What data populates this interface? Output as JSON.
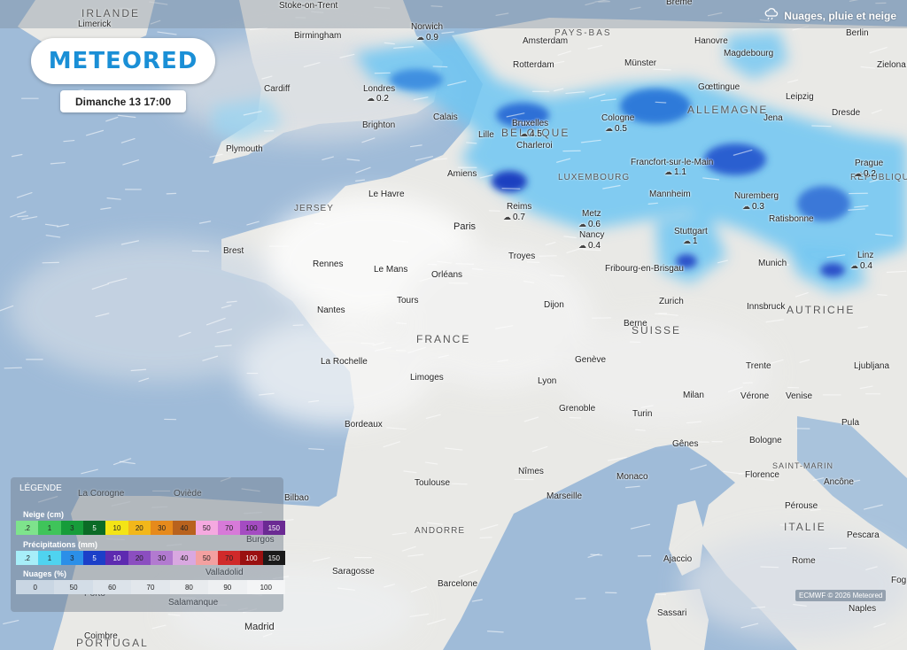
{
  "brand": {
    "name": "METEORED"
  },
  "datetime": "Dimanche 13 17:00",
  "layer": {
    "icon": "cloud-rain-snow-icon",
    "label": "Nuages, pluie et neige"
  },
  "countries": {
    "irlande": "IRLANDE",
    "pays_bas": "PAYS-BAS",
    "belgique": "BELGIQUE",
    "allemagne": "ALLEMAGNE",
    "luxembourg": "LUXEMBOURG",
    "france": "FRANCE",
    "suisse": "SUISSE",
    "autriche": "AUTRICHE",
    "republique": "RÉPUBLIQUE",
    "italie": "ITALIE",
    "saint_marin": "SAINT-MARIN",
    "andorre": "ANDORRE",
    "portugal": "PORTUGAL",
    "jersey": "JERSEY"
  },
  "cities": {
    "limerick": "Limerick",
    "stoke": "Stoke-on-Trent",
    "breme": "Brême",
    "birmingham": "Birmingham",
    "norwich": "Norwich",
    "amsterdam": "Amsterdam",
    "hanovre": "Hanovre",
    "berlin": "Berlin",
    "magdebourg": "Magdebourg",
    "zielona": "Zielona",
    "cardiff": "Cardiff",
    "londres": "Londres",
    "rotterdam": "Rotterdam",
    "munster": "Münster",
    "goettingue": "Gœttingue",
    "leipzig": "Leipzig",
    "dresde": "Dresde",
    "plymouth": "Plymouth",
    "brighton": "Brighton",
    "calais": "Calais",
    "bruxelles": "Bruxelles",
    "lille": "Lille",
    "charleroi": "Charleroi",
    "cologne": "Cologne",
    "jena": "Jena",
    "francfort": "Francfort-sur-le-Main",
    "prague": "Prague",
    "amiens": "Amiens",
    "le_havre": "Le Havre",
    "reims": "Reims",
    "metz": "Metz",
    "mannheim": "Mannheim",
    "nuremberg": "Nuremberg",
    "ratisbonne": "Ratisbonne",
    "paris": "Paris",
    "nancy": "Nancy",
    "stuttgart": "Stuttgart",
    "brest": "Brest",
    "rennes": "Rennes",
    "le_mans": "Le Mans",
    "orleans": "Orléans",
    "troyes": "Troyes",
    "fribourg": "Fribourg-en-Brisgau",
    "munich": "Munich",
    "linz": "Linz",
    "nantes": "Nantes",
    "tours": "Tours",
    "dijon": "Dijon",
    "zurich": "Zurich",
    "innsbruck": "Innsbruck",
    "berne": "Berne",
    "la_rochelle": "La Rochelle",
    "geneve": "Genève",
    "trente": "Trente",
    "ljubljana": "Ljubljana",
    "limoges": "Limoges",
    "lyon": "Lyon",
    "milan": "Milan",
    "verone": "Vérone",
    "venise": "Venise",
    "grenoble": "Grenoble",
    "turin": "Turin",
    "bordeaux": "Bordeaux",
    "pula": "Pula",
    "genes": "Gênes",
    "bologne": "Bologne",
    "la_corogne": "La Corogne",
    "oviede": "Oviède",
    "bilbao": "Bilbao",
    "toulouse": "Toulouse",
    "nimes": "Nîmes",
    "monaco": "Monaco",
    "florence": "Florence",
    "ancone": "Ancône",
    "marseille": "Marseille",
    "perouse": "Pérouse",
    "burgos": "Burgos",
    "pescara": "Pescara",
    "ajaccio": "Ajaccio",
    "rome": "Rome",
    "fog": "Fog",
    "saragosse": "Saragosse",
    "barcelone": "Barcelone",
    "valladolid": "Valladolid",
    "porto": "Porto",
    "salamanque": "Salamanque",
    "sassari": "Sassari",
    "naples": "Naples",
    "coimbre": "Coimbre",
    "madrid": "Madrid"
  },
  "precip_values": {
    "norwich": "0.9",
    "londres": "0.2",
    "bruxelles": "4.5",
    "cologne": "0.5",
    "francfort": "1.1",
    "prague": "0.2",
    "reims": "0.7",
    "metz": "0.6",
    "nancy": "0.4",
    "nuremberg": "0.3",
    "stuttgart": "1",
    "linz": "0.4"
  },
  "legend": {
    "title": "LÉGENDE",
    "snow": {
      "title": "Neige (cm)",
      "stops": [
        {
          "label": ".2",
          "color": "#7ee38c"
        },
        {
          "label": "1",
          "color": "#3fc45a"
        },
        {
          "label": "3",
          "color": "#169c3a"
        },
        {
          "label": "5",
          "color": "#0b6b26"
        },
        {
          "label": "10",
          "color": "#f3e416"
        },
        {
          "label": "20",
          "color": "#f2b71a"
        },
        {
          "label": "30",
          "color": "#e68a1c"
        },
        {
          "label": "40",
          "color": "#b8621e"
        },
        {
          "label": "50",
          "color": "#f5a9e0"
        },
        {
          "label": "70",
          "color": "#d77ad8"
        },
        {
          "label": "100",
          "color": "#a44cc2"
        },
        {
          "label": "150",
          "color": "#6b2a93"
        }
      ]
    },
    "rain": {
      "title": "Précipitations (mm)",
      "stops": [
        {
          "label": ".2",
          "color": "#a7eef9"
        },
        {
          "label": "1",
          "color": "#4fd3f0"
        },
        {
          "label": "3",
          "color": "#2b8fe8"
        },
        {
          "label": "5",
          "color": "#1c3fc8"
        },
        {
          "label": "10",
          "color": "#5d2ab0"
        },
        {
          "label": "20",
          "color": "#8b4ec0"
        },
        {
          "label": "30",
          "color": "#b27ad0"
        },
        {
          "label": "40",
          "color": "#d9a8e0"
        },
        {
          "label": "50",
          "color": "#f3a0a0"
        },
        {
          "label": "70",
          "color": "#d02a2a"
        },
        {
          "label": "100",
          "color": "#9a1010"
        },
        {
          "label": "150",
          "color": "#1a1a1a"
        }
      ]
    },
    "clouds": {
      "title": "Nuages (%)",
      "stops": [
        {
          "label": "0",
          "color": "#c9d6e3"
        },
        {
          "label": "50",
          "color": "#d3dde7"
        },
        {
          "label": "60",
          "color": "#dce3ea"
        },
        {
          "label": "70",
          "color": "#e2e7ec"
        },
        {
          "label": "80",
          "color": "#e8ebee"
        },
        {
          "label": "90",
          "color": "#eef0f2"
        },
        {
          "label": "100",
          "color": "#f4f5f6"
        }
      ]
    }
  },
  "copyright": "ECMWF © 2026 Meteored"
}
